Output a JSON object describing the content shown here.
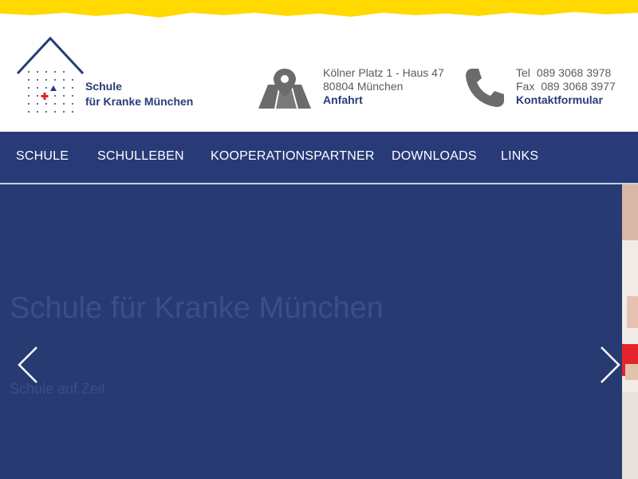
{
  "brand": {
    "line1": "Schule",
    "line2": "für Kranke München",
    "primary_color": "#283a78",
    "accent_yellow": "#ffd900",
    "cross_color": "#e0232a"
  },
  "address": {
    "line1": "Kölner Platz 1 - Haus 47",
    "line2": "80804 München",
    "link": "Anfahrt",
    "icon": "map-pin-icon"
  },
  "contact": {
    "tel_label": "Tel",
    "tel": "089 3068 3978",
    "fax_label": "Fax",
    "fax": "089 3068 3977",
    "link": "Kontaktformular",
    "icon": "phone-icon"
  },
  "nav": {
    "items": [
      {
        "label": "SCHULE"
      },
      {
        "label": "SCHULLEBEN"
      },
      {
        "label": "KOOPERATIONSPARTNER"
      },
      {
        "label": "DOWNLOADS"
      },
      {
        "label": "LINKS"
      }
    ]
  },
  "hero": {
    "title": "Schule für Kranke München",
    "subtitle": "Schule auf Zeit",
    "prev_icon": "chevron-left-icon",
    "next_icon": "chevron-right-icon"
  }
}
